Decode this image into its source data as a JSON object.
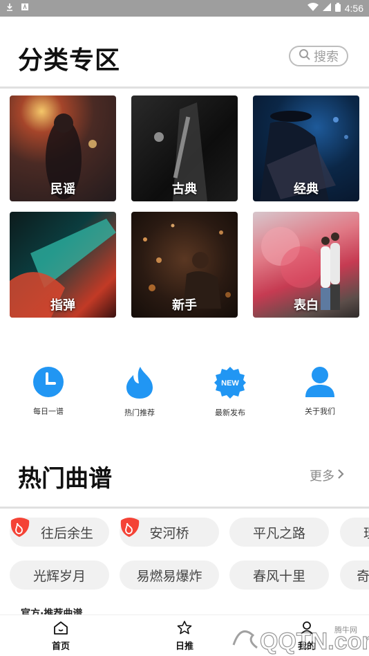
{
  "status_bar": {
    "time": "4:56"
  },
  "header": {
    "title": "分类专区",
    "search_label": "搜索"
  },
  "categories": [
    {
      "label": "民谣"
    },
    {
      "label": "古典"
    },
    {
      "label": "经典"
    },
    {
      "label": "指弹"
    },
    {
      "label": "新手"
    },
    {
      "label": "表白"
    }
  ],
  "quick_links": [
    {
      "label": "每日一谱",
      "icon": "clock-icon"
    },
    {
      "label": "热门推荐",
      "icon": "flame-icon"
    },
    {
      "label": "最新发布",
      "icon": "new-badge-icon",
      "badge_text": "NEW"
    },
    {
      "label": "关于我们",
      "icon": "person-icon"
    }
  ],
  "hot": {
    "title": "热门曲谱",
    "more_label": "更多",
    "tags_row1": [
      "往后余生",
      "安河桥",
      "平凡之路",
      "理"
    ],
    "tags_row2": [
      "光辉岁月",
      "易燃易爆炸",
      "春风十里",
      "奇"
    ]
  },
  "promo_text": "官方·推荐曲谱",
  "bottom_nav": [
    {
      "label": "首页",
      "icon": "home-icon"
    },
    {
      "label": "日推",
      "icon": "star-icon"
    },
    {
      "label": "我的",
      "icon": "user-icon"
    }
  ],
  "watermark": {
    "text": "腾牛网",
    "brand": "QQTN.com"
  },
  "colors": {
    "accent_blue": "#2196F3",
    "hot_red": "#F44336",
    "tag_bg": "#F1F1F1"
  }
}
